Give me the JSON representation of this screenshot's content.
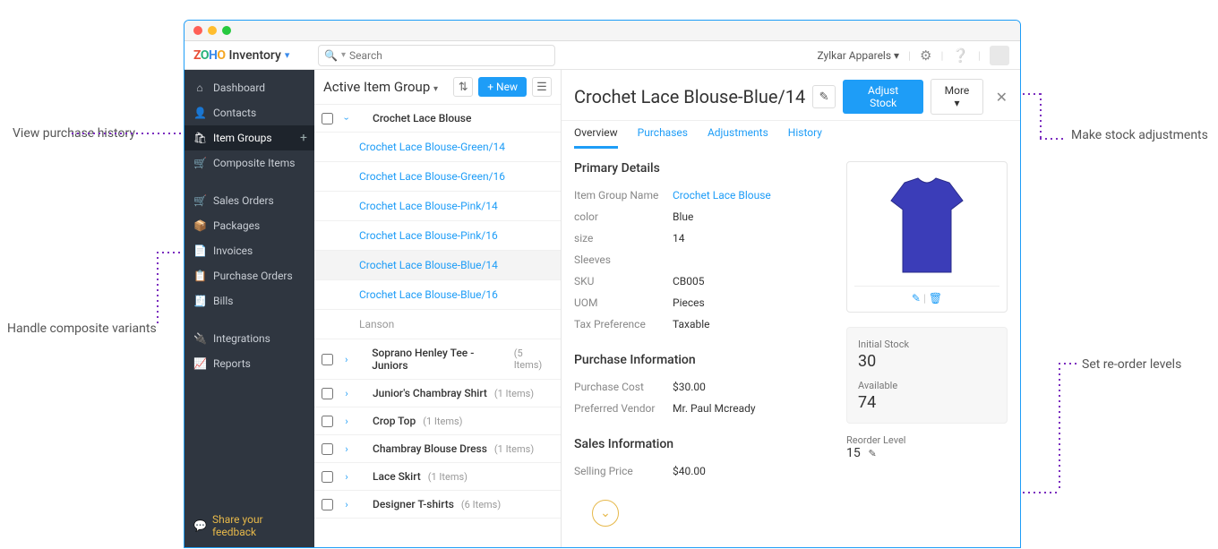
{
  "brand": {
    "name": "Inventory"
  },
  "search": {
    "placeholder": "Search"
  },
  "company": "Zylkar Apparels",
  "sidebar": {
    "items": [
      {
        "label": "Dashboard",
        "icon": "⌂"
      },
      {
        "label": "Contacts",
        "icon": "👤"
      },
      {
        "label": "Item Groups",
        "icon": "🛍",
        "active": true,
        "plus": true
      },
      {
        "label": "Composite Items",
        "icon": "🛒"
      }
    ],
    "items2": [
      {
        "label": "Sales Orders",
        "icon": "🛒"
      },
      {
        "label": "Packages",
        "icon": "📦"
      },
      {
        "label": "Invoices",
        "icon": "📄"
      },
      {
        "label": "Purchase Orders",
        "icon": "📋"
      },
      {
        "label": "Bills",
        "icon": "🧾"
      }
    ],
    "items3": [
      {
        "label": "Integrations",
        "icon": "🔌"
      },
      {
        "label": "Reports",
        "icon": "📈"
      }
    ],
    "feedback": "Share your feedback"
  },
  "list": {
    "title": "Active Item Group",
    "new_label": "New",
    "groups": [
      {
        "name": "Crochet Lace Blouse",
        "expanded": true,
        "variants": [
          {
            "name": "Crochet Lace Blouse-Green/14"
          },
          {
            "name": "Crochet Lace Blouse-Green/16"
          },
          {
            "name": "Crochet Lace Blouse-Pink/14"
          },
          {
            "name": "Crochet Lace Blouse-Pink/16"
          },
          {
            "name": "Crochet Lace Blouse-Blue/14",
            "selected": true
          },
          {
            "name": "Crochet Lace Blouse-Blue/16"
          },
          {
            "name": "Lanson",
            "muted": true
          }
        ]
      },
      {
        "name": "Soprano Henley Tee - Juniors",
        "count": "(5 Items)"
      },
      {
        "name": "Junior's Chambray Shirt",
        "count": "(1 Items)"
      },
      {
        "name": "Crop Top",
        "count": "(1 Items)"
      },
      {
        "name": "Chambray Blouse Dress",
        "count": "(1 Items)"
      },
      {
        "name": "Lace Skirt",
        "count": "(1 Items)"
      },
      {
        "name": "Designer T-shirts",
        "count": "(6 Items)"
      }
    ]
  },
  "detail": {
    "title": "Crochet Lace Blouse-Blue/14",
    "adjust_label": "Adjust Stock",
    "more_label": "More",
    "tabs": [
      "Overview",
      "Purchases",
      "Adjustments",
      "History"
    ],
    "primary_title": "Primary Details",
    "primary": [
      {
        "k": "Item Group Name",
        "v": "Crochet Lace Blouse",
        "link": true
      },
      {
        "k": "color",
        "v": "Blue"
      },
      {
        "k": "size",
        "v": "14"
      },
      {
        "k": "Sleeves",
        "v": ""
      },
      {
        "k": "SKU",
        "v": "CB005"
      },
      {
        "k": "UOM",
        "v": "Pieces"
      },
      {
        "k": "Tax Preference",
        "v": "Taxable"
      }
    ],
    "purchase_title": "Purchase Information",
    "purchase": [
      {
        "k": "Purchase Cost",
        "v": "$30.00"
      },
      {
        "k": "Preferred Vendor",
        "v": "Mr. Paul Mcready"
      }
    ],
    "sales_title": "Sales Information",
    "sales": [
      {
        "k": "Selling Price",
        "v": "$40.00"
      }
    ],
    "stock": {
      "initial_label": "Initial Stock",
      "initial": "30",
      "available_label": "Available",
      "available": "74",
      "reorder_label": "Reorder Level",
      "reorder": "15"
    }
  },
  "annotations": {
    "purchase_history": "View purchase history",
    "composite": "Handle composite variants",
    "stock_adj": "Make stock adjustments",
    "reorder": "Set re-order levels"
  }
}
